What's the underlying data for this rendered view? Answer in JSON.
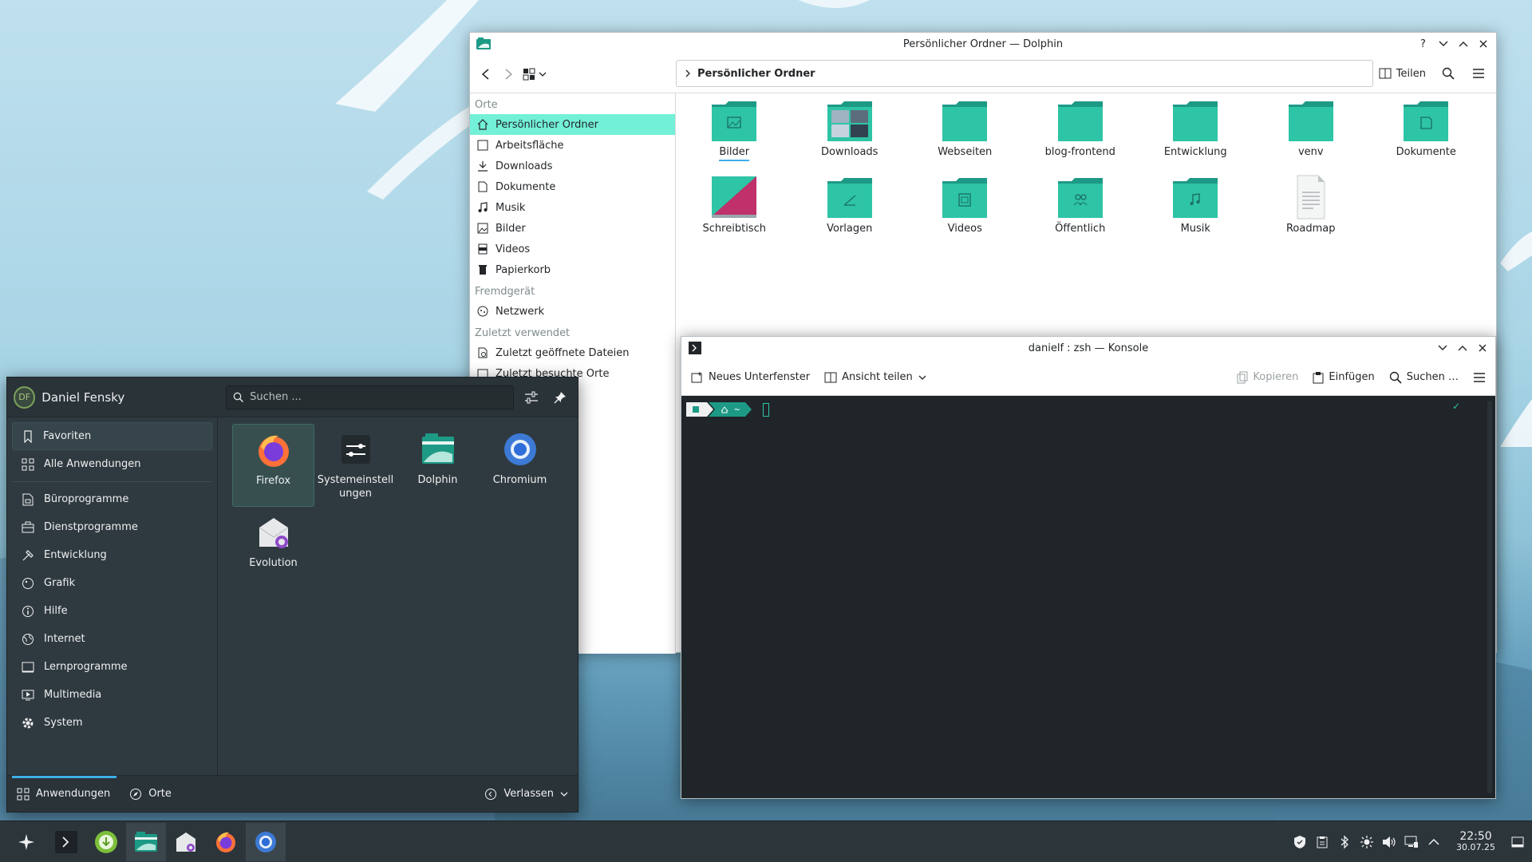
{
  "dolphin": {
    "title": "Persönlicher Ordner — Dolphin",
    "path": "Persönlicher Ordner",
    "share_label": "Teilen",
    "sections": {
      "orte": "Orte",
      "fremdgeraet": "Fremdgerät",
      "zuletzt": "Zuletzt verwendet"
    },
    "places": [
      "Persönlicher Ordner",
      "Arbeitsfläche",
      "Downloads",
      "Dokumente",
      "Musik",
      "Bilder",
      "Videos",
      "Papierkorb"
    ],
    "remote": [
      "Netzwerk"
    ],
    "recent": [
      "Zuletzt geöffnete Dateien",
      "Zuletzt besuchte Orte"
    ],
    "files": [
      "Bilder",
      "Downloads",
      "Webseiten",
      "blog-frontend",
      "Entwicklung",
      "venv",
      "Dokumente",
      "Schreibtisch",
      "Vorlagen",
      "Videos",
      "Öffentlich",
      "Musik",
      "Roadmap"
    ]
  },
  "konsole": {
    "title": "danielf : zsh — Konsole",
    "new_tab": "Neues Unterfenster",
    "split": "Ansicht teilen",
    "copy": "Kopieren",
    "paste": "Einfügen",
    "find": "Suchen …",
    "prompt_dir": "~"
  },
  "launcher": {
    "user_initials": "DF",
    "user_name": "Daniel Fensky",
    "search_placeholder": "Suchen ...",
    "categories": [
      "Favoriten",
      "Alle Anwendungen",
      "Büroprogramme",
      "Dienstprogramme",
      "Entwicklung",
      "Grafik",
      "Hilfe",
      "Internet",
      "Lernprogramme",
      "Multimedia",
      "System"
    ],
    "apps": [
      "Firefox",
      "Systemeinstell ungen",
      "Dolphin",
      "Chromium",
      "Evolution"
    ],
    "footer": {
      "apps": "Anwendungen",
      "places": "Orte",
      "leave": "Verlassen"
    }
  },
  "taskbar": {
    "time": "22:50",
    "date": "30.07.25"
  }
}
